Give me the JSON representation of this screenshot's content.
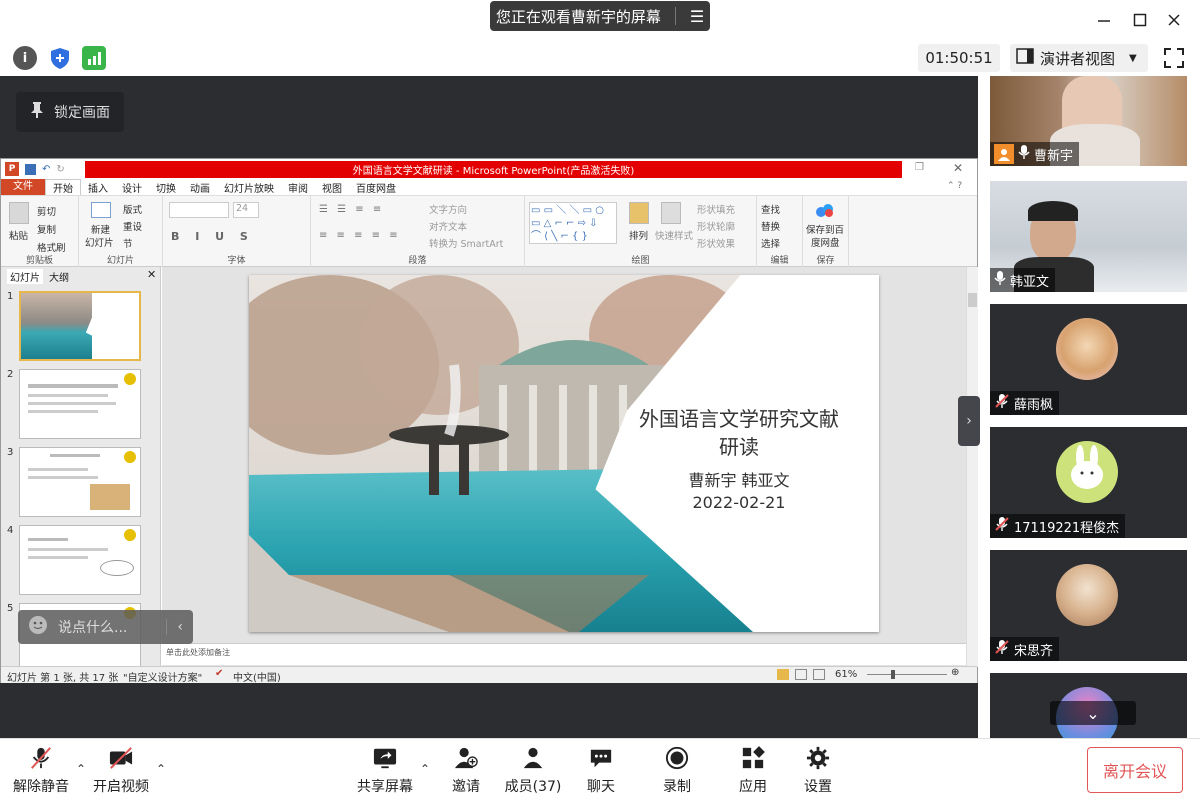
{
  "title_bar": {
    "viewing_text": "您正在观看曹新宇的屏幕"
  },
  "toolbar": {
    "timer": "01:50:51",
    "view_mode": "演讲者视图"
  },
  "stage": {
    "lock_label": "锁定画面"
  },
  "ppt": {
    "window_title": "外国语言文学文献研读 - Microsoft PowerPoint(产品激活失败)",
    "menu": [
      "文件",
      "开始",
      "插入",
      "设计",
      "切换",
      "动画",
      "幻灯片放映",
      "审阅",
      "视图",
      "百度网盘"
    ],
    "ribbon": {
      "clipboard": {
        "paste": "粘贴",
        "cut": "剪切",
        "copy": "复制",
        "format_painter": "格式刷",
        "label": "剪贴板"
      },
      "slides": {
        "new_slide_1": "新建",
        "new_slide_2": "幻灯片",
        "layout": "版式",
        "reset": "重设",
        "section": "节",
        "label": "幻灯片"
      },
      "font": {
        "size": "24",
        "label": "字体"
      },
      "paragraph": {
        "text_direction": "文字方向",
        "align_text": "对齐文本",
        "smartart": "转换为 SmartArt",
        "label": "段落"
      },
      "drawing": {
        "arrange": "排列",
        "quick_styles": "快速样式",
        "fill": "形状填充",
        "outline": "形状轮廓",
        "effects": "形状效果",
        "label": "绘图"
      },
      "editing": {
        "find": "查找",
        "replace": "替换",
        "select": "选择",
        "label": "编辑"
      },
      "save": {
        "save_1": "保存到百",
        "save_2": "度网盘",
        "label": "保存"
      }
    },
    "pane_tabs": [
      "幻灯片",
      "大纲"
    ],
    "slide_numbers": [
      "1",
      "2",
      "3",
      "4",
      "5"
    ],
    "slide": {
      "title_line1": "外国语言文学研究文献",
      "title_line2": "研读",
      "authors": "曹新宇  韩亚文",
      "date": "2022-02-21"
    },
    "notes_placeholder": "单击此处添加备注",
    "status": {
      "slide_info": "幻灯片 第 1 张, 共 17 张",
      "theme": "\"自定义设计方案\"",
      "language": "中文(中国)",
      "zoom": "61%"
    }
  },
  "chat": {
    "placeholder": "说点什么..."
  },
  "participants": [
    {
      "name": "曹新宇"
    },
    {
      "name": "韩亚文"
    },
    {
      "name": "薛雨枫"
    },
    {
      "name": "17119221程俊杰"
    },
    {
      "name": "宋思齐"
    }
  ],
  "bottom_bar": {
    "unmute": "解除静音",
    "start_video": "开启视频",
    "share_screen": "共享屏幕",
    "invite": "邀请",
    "members": "成员(37)",
    "chat": "聊天",
    "record": "录制",
    "apps": "应用",
    "settings": "设置",
    "leave": "离开会议"
  },
  "colors": {
    "accent_red": "#e15656",
    "ppt_red": "#e30000",
    "stage_bg": "#2b2d31"
  }
}
